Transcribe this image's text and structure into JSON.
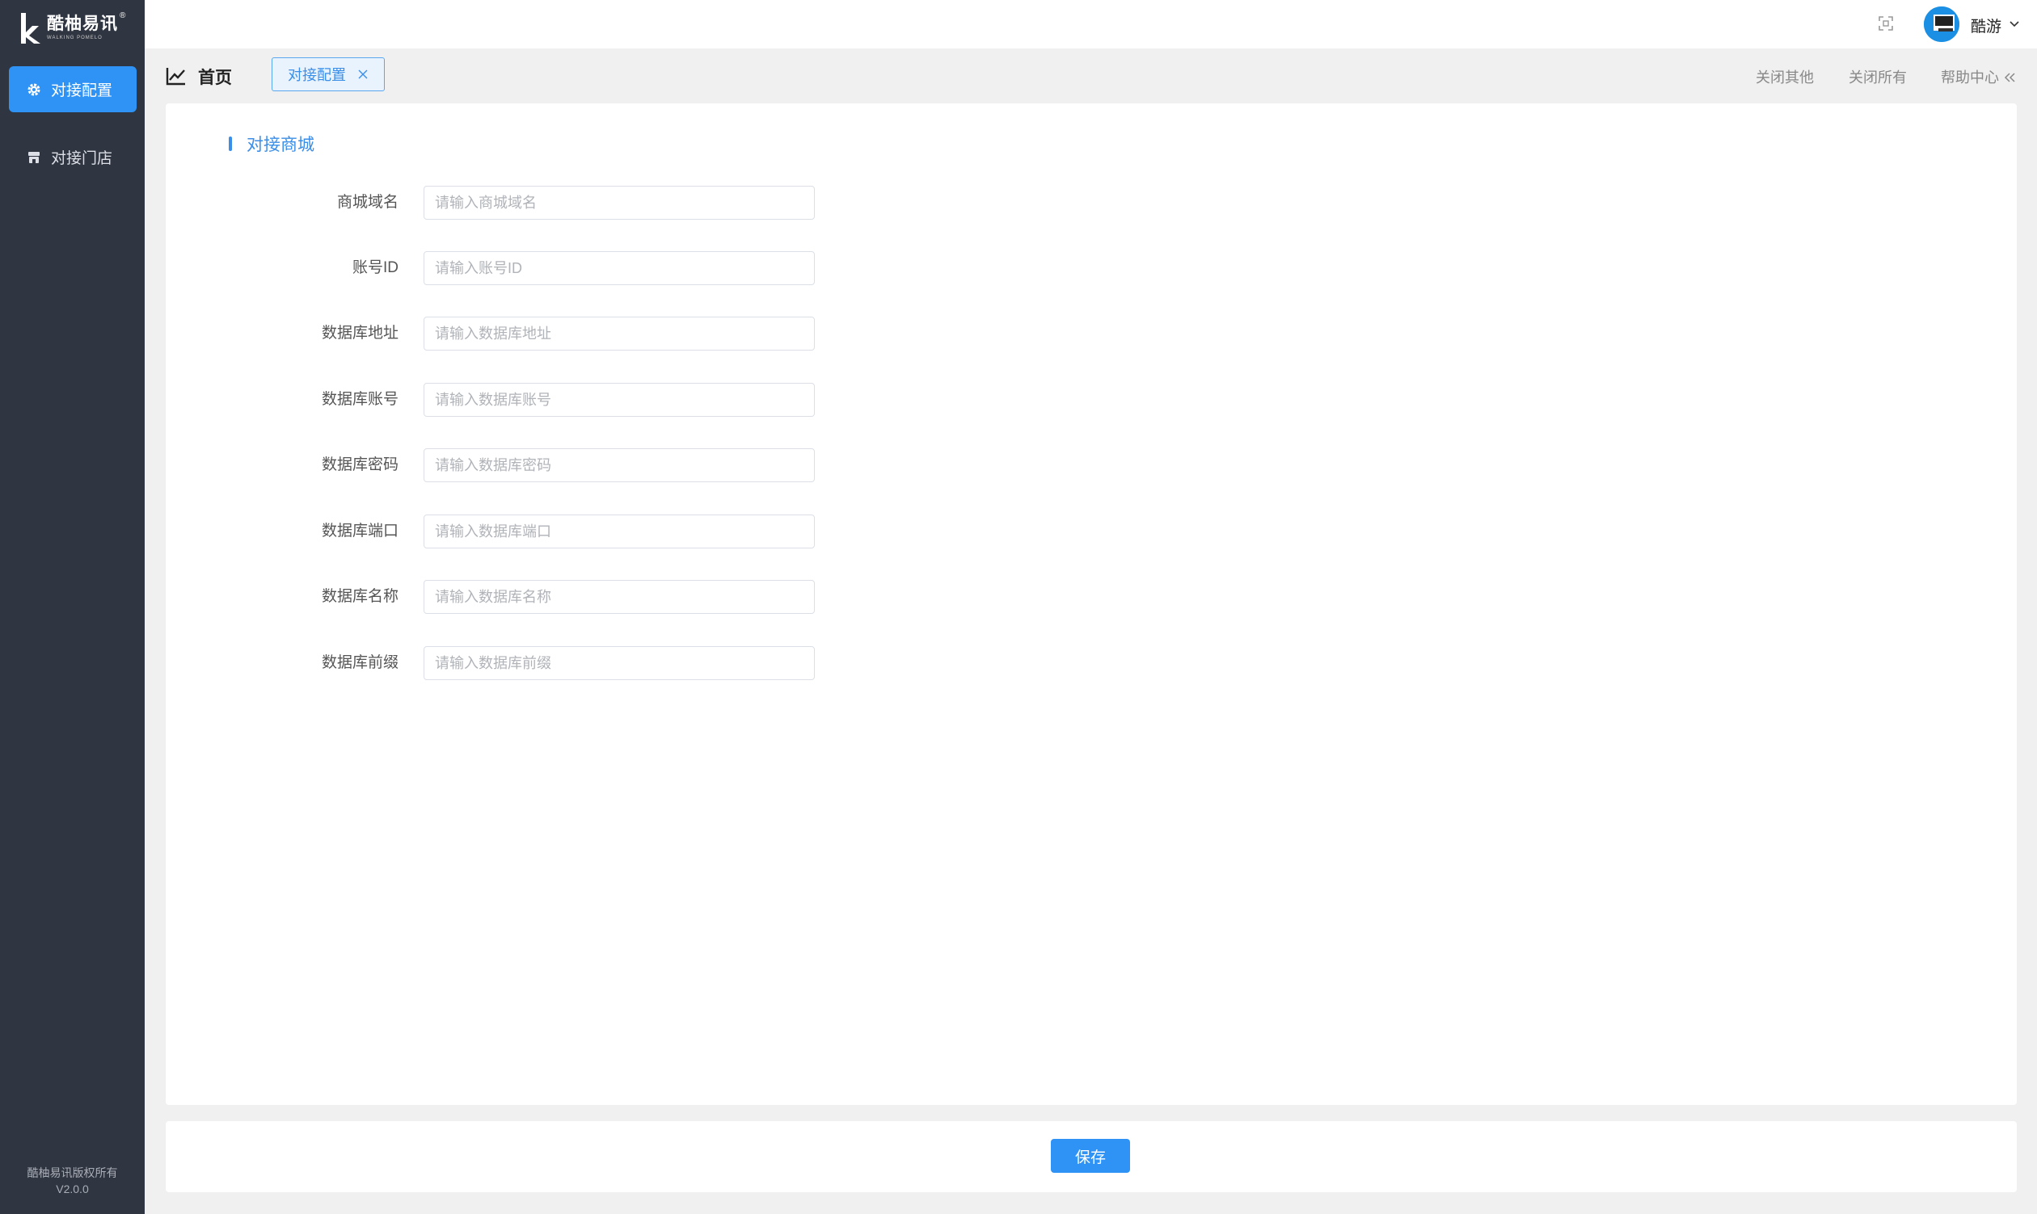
{
  "brand": {
    "name": "酷柚易讯",
    "subtitle": "WALKING POMELO",
    "registered": "®"
  },
  "sidebar": {
    "items": [
      {
        "label": "对接配置",
        "icon": "gear-icon",
        "active": true
      },
      {
        "label": "对接门店",
        "icon": "store-icon",
        "active": false
      }
    ],
    "copyright": "酷柚易讯版权所有",
    "version": "V2.0.0"
  },
  "header": {
    "username": "酷游",
    "fullscreen_icon": "fullscreen-icon",
    "caret_icon": "chevron-down-icon"
  },
  "tabs": {
    "home_label": "首页",
    "open_tabs": [
      {
        "label": "对接配置"
      }
    ],
    "close_others": "关闭其他",
    "close_all": "关闭所有",
    "help_center": "帮助中心"
  },
  "form": {
    "section_title": "对接商城",
    "fields": [
      {
        "label": "商城域名",
        "placeholder": "请输入商城域名",
        "value": ""
      },
      {
        "label": "账号ID",
        "placeholder": "请输入账号ID",
        "value": ""
      },
      {
        "label": "数据库地址",
        "placeholder": "请输入数据库地址",
        "value": ""
      },
      {
        "label": "数据库账号",
        "placeholder": "请输入数据库账号",
        "value": ""
      },
      {
        "label": "数据库密码",
        "placeholder": "请输入数据库密码",
        "value": ""
      },
      {
        "label": "数据库端口",
        "placeholder": "请输入数据库端口",
        "value": ""
      },
      {
        "label": "数据库名称",
        "placeholder": "请输入数据库名称",
        "value": ""
      },
      {
        "label": "数据库前缀",
        "placeholder": "请输入数据库前缀",
        "value": ""
      }
    ]
  },
  "footer": {
    "save_label": "保存"
  },
  "colors": {
    "primary": "#2f93f5",
    "sidebar_bg": "#2f3541",
    "page_bg": "#f0f0f0"
  }
}
